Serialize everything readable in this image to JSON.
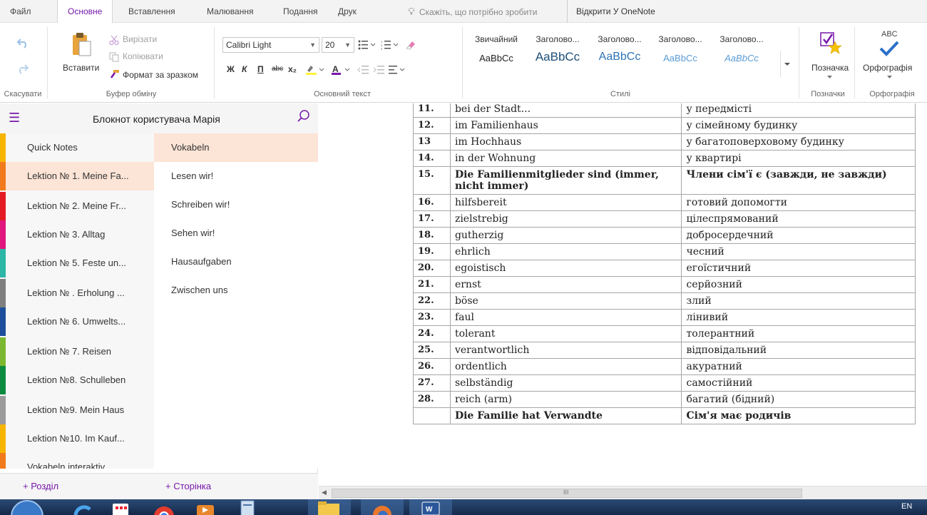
{
  "menu": {
    "tabs": [
      "Файл",
      "Основне",
      "Вставлення",
      "Малювання",
      "Подання",
      "Друк"
    ],
    "active": "Основне",
    "tell_me": "Скажіть, що потрібно зробити",
    "open_onenote": "Відкрити У OneNote"
  },
  "ribbon": {
    "undo_group_label": "Скасувати",
    "clipboard": {
      "paste": "Вставити",
      "cut": "Вирізати",
      "copy": "Копіювати",
      "format_painter": "Формат за зразком",
      "label": "Буфер обміну"
    },
    "font": {
      "name": "Calibri Light",
      "size": "20",
      "bold": "Ж",
      "italic": "К",
      "underline": "П",
      "strike": "abc",
      "subscript": "x₂",
      "label": "Основний текст"
    },
    "styles": {
      "label": "Стилі",
      "items": [
        {
          "name": "Звичайний",
          "sample": "AaBbCc"
        },
        {
          "name": "Заголово...",
          "sample": "AaBbCc"
        },
        {
          "name": "Заголово...",
          "sample": "AaBbCc"
        },
        {
          "name": "Заголово...",
          "sample": "AaBbCc"
        },
        {
          "name": "Заголово...",
          "sample": "AaBbCc"
        }
      ]
    },
    "tags": {
      "button": "Позначка",
      "label": "Позначки"
    },
    "spelling": {
      "button": "Орфографія",
      "label": "Орфографія",
      "abc": "ABC"
    }
  },
  "nav": {
    "notebook_title": "Блокнот користувача Марія",
    "sections": [
      {
        "label": "Quick Notes",
        "color": "#f7b500"
      },
      {
        "label": "Lektion № 1. Meine Fa...",
        "color": "#f07a1c"
      },
      {
        "label": "Lektion № 2. Meine Fr...",
        "color": "#e51b24"
      },
      {
        "label": "Lektion № 3. Alltag",
        "color": "#e0157e"
      },
      {
        "label": "Lektion № 5. Feste un...",
        "color": "#2bb6a6"
      },
      {
        "label": "Lektion № . Erholung ...",
        "color": "#7f7f7f"
      },
      {
        "label": "Lektion № 6. Umwelts...",
        "color": "#1e4f9c"
      },
      {
        "label": "Lektion № 7. Reisen",
        "color": "#7cb82f"
      },
      {
        "label": "Lektion №8. Schulleben",
        "color": "#0c8a3f"
      },
      {
        "label": "Lektion №9. Mein Haus",
        "color": "#9b9b9b"
      },
      {
        "label": "Lektion №10. Im Kauf...",
        "color": "#f7b500"
      },
      {
        "label": "Vokabeln interaktiv",
        "color": "#f07a1c"
      }
    ],
    "selected_section": 1,
    "pages": [
      "Vokabeln",
      "Lesen wir!",
      "Schreiben wir!",
      "Sehen wir!",
      "Hausaufgaben",
      "Zwischen uns"
    ],
    "selected_page": 0,
    "add_section": "+ Розділ",
    "add_page": "+ Сторінка"
  },
  "vocab": [
    {
      "num": "11.",
      "de": "bei der Stadt...",
      "ua": "у передмісті"
    },
    {
      "num": "12.",
      "de": "im Familienhaus",
      "ua": "у сімейному будинку"
    },
    {
      "num": "13",
      "de": "im Hochhaus",
      "ua": "у багатоповерховому будинку"
    },
    {
      "num": "14.",
      "de": "in der Wohnung",
      "ua": "у квартирі"
    },
    {
      "num": "15.",
      "de": "Die Familienmitglieder sind (immer, nicht immer)",
      "ua": "Члени сім'ї є (завжди, не завжди)",
      "bold": true
    },
    {
      "num": "16.",
      "de": "hilfsbereit",
      "ua": "готовий допомогти"
    },
    {
      "num": "17.",
      "de": "zielstrebig",
      "ua": "цілеспрямований"
    },
    {
      "num": "18.",
      "de": "gutherzig",
      "ua": "добросердечний"
    },
    {
      "num": "19.",
      "de": "ehrlich",
      "ua": "чесний"
    },
    {
      "num": "20.",
      "de": "egoistisch",
      "ua": "егоїстичний"
    },
    {
      "num": "21.",
      "de": "ernst",
      "ua": "серйозний"
    },
    {
      "num": "22.",
      "de": "böse",
      "ua": "злий"
    },
    {
      "num": "23.",
      "de": "faul",
      "ua": "лінивий"
    },
    {
      "num": "24.",
      "de": "tolerant",
      "ua": "толерантний"
    },
    {
      "num": "25.",
      "de": "verantwortlich",
      "ua": "відповідальний"
    },
    {
      "num": "26.",
      "de": "ordentlich",
      "ua": "акуратний"
    },
    {
      "num": "27.",
      "de": "selbständig",
      "ua": "самостійний"
    },
    {
      "num": "28.",
      "de": "reich (arm)",
      "ua": "багатий (бідний)"
    },
    {
      "num": "",
      "de": "Die Familie hat Verwandte",
      "ua": "Сім'я має родичів",
      "bold": true
    }
  ],
  "taskbar": {
    "lang": "EN"
  },
  "colors": {
    "accent": "#7719aa",
    "selected_bg": "#fce4d6",
    "check": "#2b70c9"
  }
}
